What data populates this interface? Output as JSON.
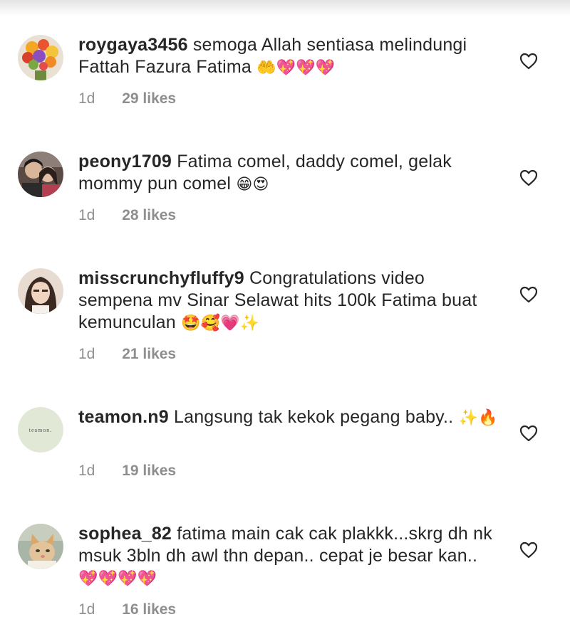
{
  "comments": [
    {
      "username": "roygaya3456",
      "text": "semoga Allah sentiasa melindungi Fattah Fazura Fatima",
      "emojis": "🤲💖💖💖",
      "time": "1d",
      "likes": "29 likes",
      "avatar_icon": "flower-bouquet-avatar"
    },
    {
      "username": "peony1709",
      "text": "Fatima comel, daddy comel, gelak mommy pun comel",
      "emojis": "😁😍",
      "time": "1d",
      "likes": "28 likes",
      "avatar_icon": "couple-photo-avatar"
    },
    {
      "username": "misscrunchyfluffy9",
      "text": "Congratulations video sempena mv Sinar Selawat hits 100k Fatima buat kemunculan",
      "emojis": "🤩🥰💗✨",
      "time": "1d",
      "likes": "21 likes",
      "avatar_icon": "woman-portrait-avatar"
    },
    {
      "username": "teamon.n9",
      "text": "Langsung tak kekok pegang baby..",
      "emojis": "✨🔥",
      "time": "1d",
      "likes": "19 likes",
      "avatar_icon": "teamon-logo-avatar",
      "avatar_text": "teamon."
    },
    {
      "username": "sophea_82",
      "text": "fatima main cak cak plakkk...skrg dh nk msuk 3bln dh awl thn depan.. cepat je besar kan..",
      "emojis": "💖💖💖💖",
      "time": "1d",
      "likes": "16 likes",
      "avatar_icon": "cat-photo-avatar"
    }
  ],
  "colors": {
    "text": "#262626",
    "meta": "#8e8e8e",
    "heart": "#262626"
  }
}
